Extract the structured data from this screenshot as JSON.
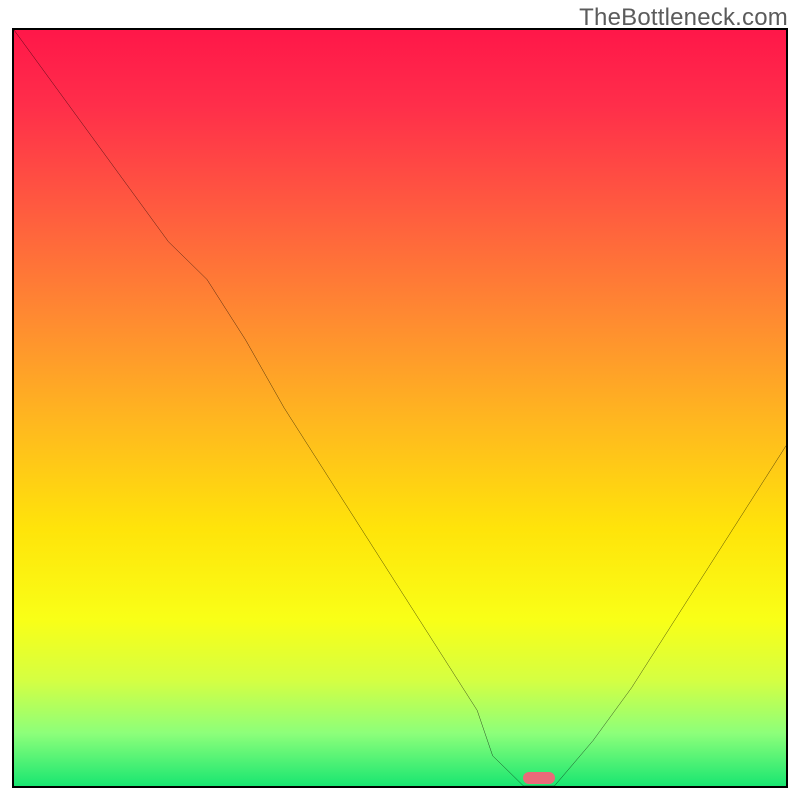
{
  "watermark": "TheBottleneck.com",
  "chart_data": {
    "type": "line",
    "title": "",
    "xlabel": "",
    "ylabel": "",
    "xlim": [
      0,
      100
    ],
    "ylim": [
      0,
      100
    ],
    "x": [
      0,
      5,
      10,
      15,
      20,
      25,
      30,
      35,
      40,
      45,
      50,
      55,
      60,
      62,
      66,
      70,
      75,
      80,
      85,
      90,
      95,
      100
    ],
    "values": [
      100,
      93,
      86,
      79,
      72,
      67,
      59,
      50,
      42,
      34,
      26,
      18,
      10,
      4,
      0,
      0,
      6,
      13,
      21,
      29,
      37,
      45
    ],
    "minimum_marker_x": 68,
    "gradient_stops": [
      {
        "pos": 0.0,
        "color": "#ff1749"
      },
      {
        "pos": 0.1,
        "color": "#ff2e4a"
      },
      {
        "pos": 0.24,
        "color": "#ff5c3f"
      },
      {
        "pos": 0.38,
        "color": "#ff8a31"
      },
      {
        "pos": 0.52,
        "color": "#ffb81f"
      },
      {
        "pos": 0.66,
        "color": "#ffe40a"
      },
      {
        "pos": 0.78,
        "color": "#f9ff17"
      },
      {
        "pos": 0.86,
        "color": "#d5ff42"
      },
      {
        "pos": 0.93,
        "color": "#8dff7a"
      },
      {
        "pos": 1.0,
        "color": "#19e671"
      }
    ]
  }
}
